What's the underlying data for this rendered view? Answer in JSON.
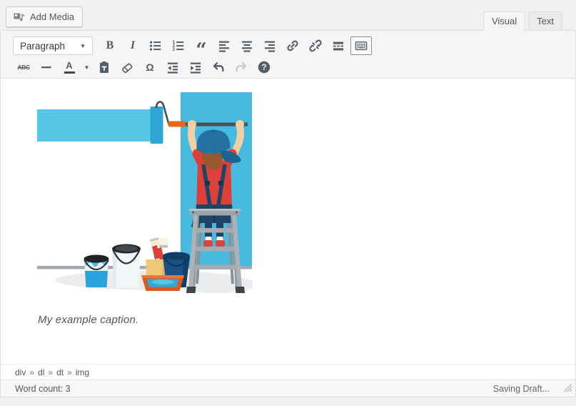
{
  "editor_tools": {
    "add_media_label": "Add Media",
    "tabs": [
      {
        "label": "Visual",
        "active": true
      },
      {
        "label": "Text",
        "active": false
      }
    ]
  },
  "toolbar": {
    "format_value": "Paragraph",
    "caret_glyph": "▼",
    "glyphs": {
      "bold": "B",
      "italic": "I",
      "quote": "“",
      "strikethrough": "ABC",
      "forecolor": "A",
      "charmap": "Ω",
      "help": "?",
      "ol1": "1",
      "ol2": "2",
      "ol3": "3"
    }
  },
  "content": {
    "caption": "My example caption."
  },
  "statusbar": {
    "path": [
      "div",
      "dl",
      "dt",
      "img"
    ],
    "separator": "»",
    "word_count_label": "Word count:",
    "word_count_value": "3",
    "saving_status": "Saving Draft..."
  },
  "colors": {
    "page-bg": "#f1f1f1",
    "border": "#dedede",
    "toolbar-bg": "#f5f5f5",
    "icon": "#555d66",
    "icon-disabled": "#c6cace",
    "button-bg": "#f7f7f7",
    "button-border": "#cccccc",
    "tab-inactive-bg": "#ebebeb",
    "content-bg": "#ffffff",
    "statusbar-bg": "#f7f7f7",
    "caption": "#555555",
    "paint-stripe": "#58C6E6",
    "paint-wall": "#47BBDF",
    "paint-roller": "#2EA5D2",
    "orange": "#E8661A",
    "navy": "#1E4566",
    "shirt-red": "#DC4038",
    "cap-blue": "#2472A4",
    "skin": "#F3CFA4",
    "hair": "#99582F",
    "ladder": "#ACB2B7",
    "bucket-navy": "#1A5283",
    "tray-orange": "#E2571B",
    "shadow": "#EAECED"
  }
}
